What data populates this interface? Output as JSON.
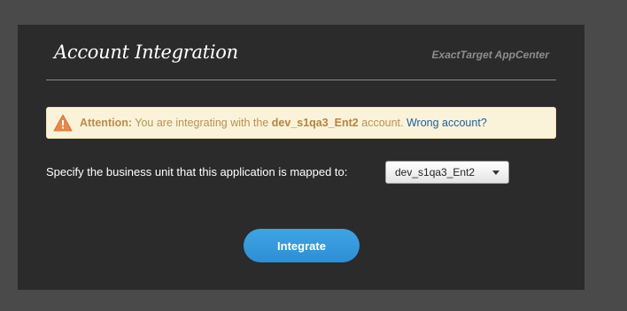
{
  "header": {
    "title": "Account Integration",
    "brand": "ExactTarget AppCenter"
  },
  "alert": {
    "icon": "warning-triangle-icon",
    "label": "Attention:",
    "message_before": " You are integrating with the ",
    "account": "dev_s1qa3_Ent2",
    "message_after": " account. ",
    "link_text": "Wrong account?"
  },
  "business_unit": {
    "label": "Specify the business unit that this application is mapped to:",
    "selected": "dev_s1qa3_Ent2"
  },
  "actions": {
    "integrate_label": "Integrate"
  },
  "colors": {
    "page_background": "#4a4a4a",
    "panel_background": "#2b2b2b",
    "alert_background": "#fbf3d9",
    "warning_icon": "#e8874a",
    "link": "#1f5e9c",
    "button": "#2f94d9"
  }
}
